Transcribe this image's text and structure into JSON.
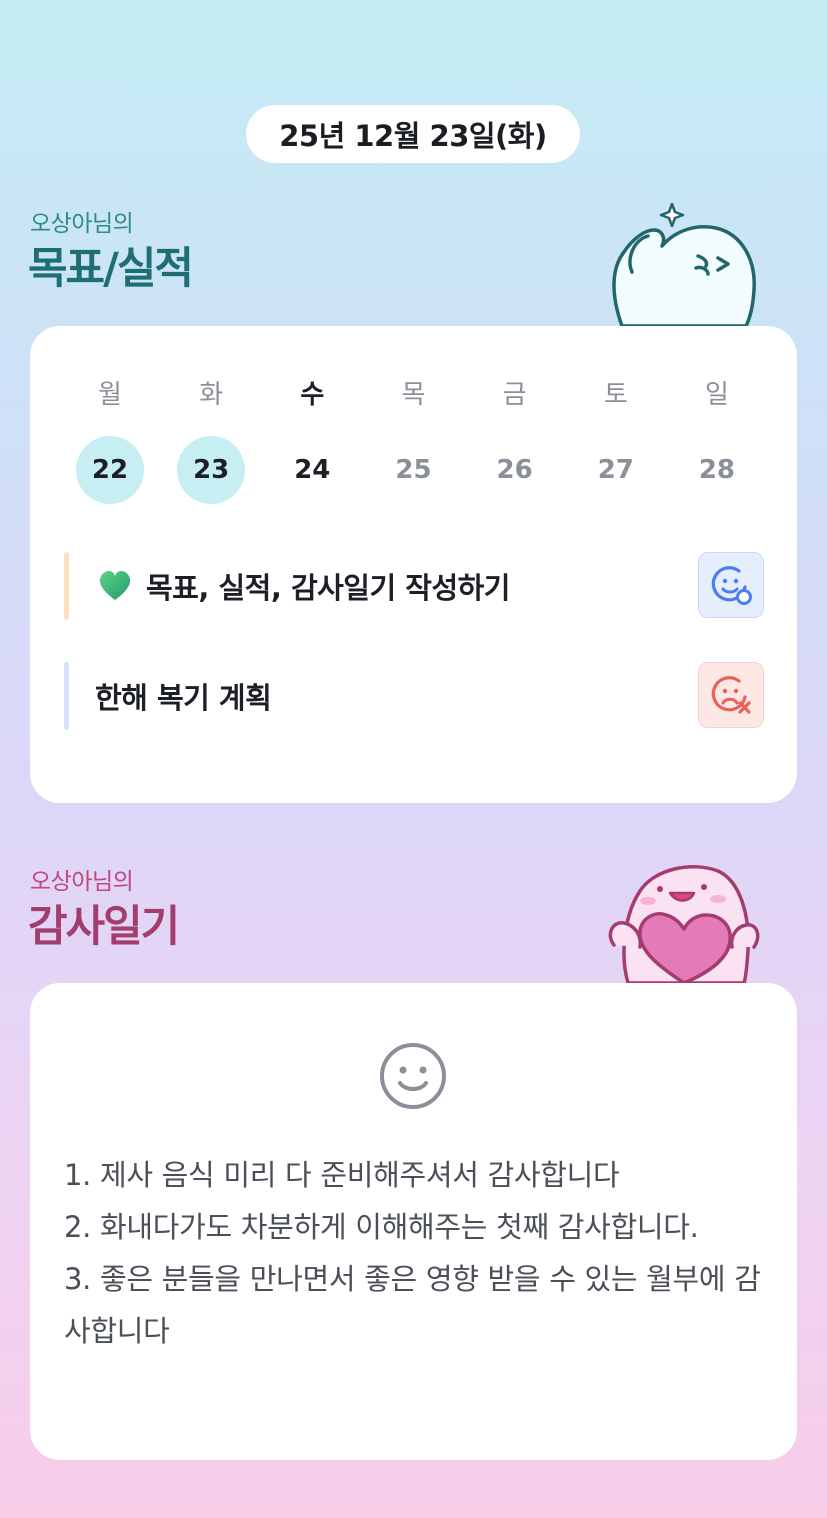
{
  "header": {
    "date": "25년 12월 23일(화)"
  },
  "goal_section": {
    "subtitle": "오상아님의",
    "title": "목표/실적",
    "days": [
      {
        "label": "월",
        "num": "22",
        "state": "done"
      },
      {
        "label": "화",
        "num": "23",
        "state": "done"
      },
      {
        "label": "수",
        "num": "24",
        "state": "today"
      },
      {
        "label": "목",
        "num": "25",
        "state": "future"
      },
      {
        "label": "금",
        "num": "26",
        "state": "future"
      },
      {
        "label": "토",
        "num": "27",
        "state": "future"
      },
      {
        "label": "일",
        "num": "28",
        "state": "future"
      }
    ],
    "tasks": [
      {
        "text": "목표, 실적, 감사일기 작성하기",
        "status": "achieved"
      },
      {
        "text": "한해 복기 계획",
        "status": "not-achieved"
      }
    ]
  },
  "diary_section": {
    "subtitle": "오상아님의",
    "title": "감사일기",
    "lines": [
      "1. 제사 음식 미리 다 준비해주셔서 감사합니다",
      "2. 화내다가도 차분하게 이해해주는 첫째 감사합니다.",
      "3. 좋은 분들을 만나면서 좋은 영향 받을 수 있는 월부에 감사합니다"
    ]
  },
  "colors": {
    "goal_title": "#1f6e72",
    "diary_title": "#a43c6e",
    "done_day_bg": "#c6eef3",
    "good_icon": "#4a7df0",
    "bad_icon": "#e8615a"
  },
  "icons": [
    "heart-icon",
    "smile-check-icon",
    "sad-x-icon",
    "smile-icon",
    "mascot-ghost",
    "mascot-heart"
  ]
}
